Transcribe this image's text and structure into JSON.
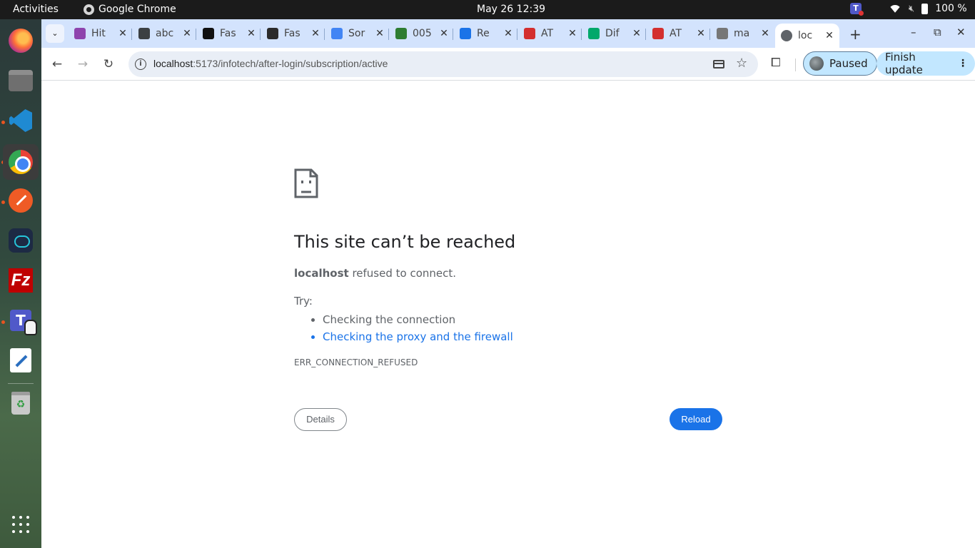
{
  "system_bar": {
    "activities": "Activities",
    "app_name": "Google Chrome",
    "clock": "May 26  12:39",
    "battery": "100 %"
  },
  "dock": {
    "apps": [
      "Firefox",
      "Files",
      "Visual Studio Code",
      "Google Chrome",
      "Postman",
      "Cloud App",
      "FileZilla",
      "Microsoft Teams",
      "Text Editor",
      "Trash",
      "Show Applications"
    ],
    "filezilla_glyph": "Fz",
    "teams_glyph": "T"
  },
  "tabs": [
    {
      "title": "Hit",
      "favicon": "#8e44ad"
    },
    {
      "title": "abc",
      "favicon": "#3c4043"
    },
    {
      "title": "Fas",
      "favicon": "#111111"
    },
    {
      "title": "Fas",
      "favicon": "#2b2b2b"
    },
    {
      "title": "Sor",
      "favicon": "#4285f4"
    },
    {
      "title": "005",
      "favicon": "#2e7d32"
    },
    {
      "title": "Re",
      "favicon": "#1a73e8"
    },
    {
      "title": "AT",
      "favicon": "#d32f2f"
    },
    {
      "title": "Dif",
      "favicon": "#00a86b"
    },
    {
      "title": "AT",
      "favicon": "#d32f2f"
    },
    {
      "title": "ma",
      "favicon": "#777777"
    },
    {
      "title": "loc",
      "favicon": "#5f6368",
      "active": true
    }
  ],
  "toolbar": {
    "url_host": "localhost",
    "url_path": ":5173/infotech/after-login/subscription/active",
    "profile_label": "Paused",
    "update_label": "Finish update"
  },
  "error_page": {
    "title": "This site can’t be reached",
    "host": "localhost",
    "message": " refused to connect.",
    "try_label": "Try:",
    "suggestions": [
      "Checking the connection",
      "Checking the proxy and the firewall"
    ],
    "error_code": "ERR_CONNECTION_REFUSED",
    "details_button": "Details",
    "reload_button": "Reload"
  },
  "colors": {
    "accent": "#1a73e8",
    "tabstrip": "#d3e3fd",
    "profile_chip": "#c2e7ff"
  }
}
